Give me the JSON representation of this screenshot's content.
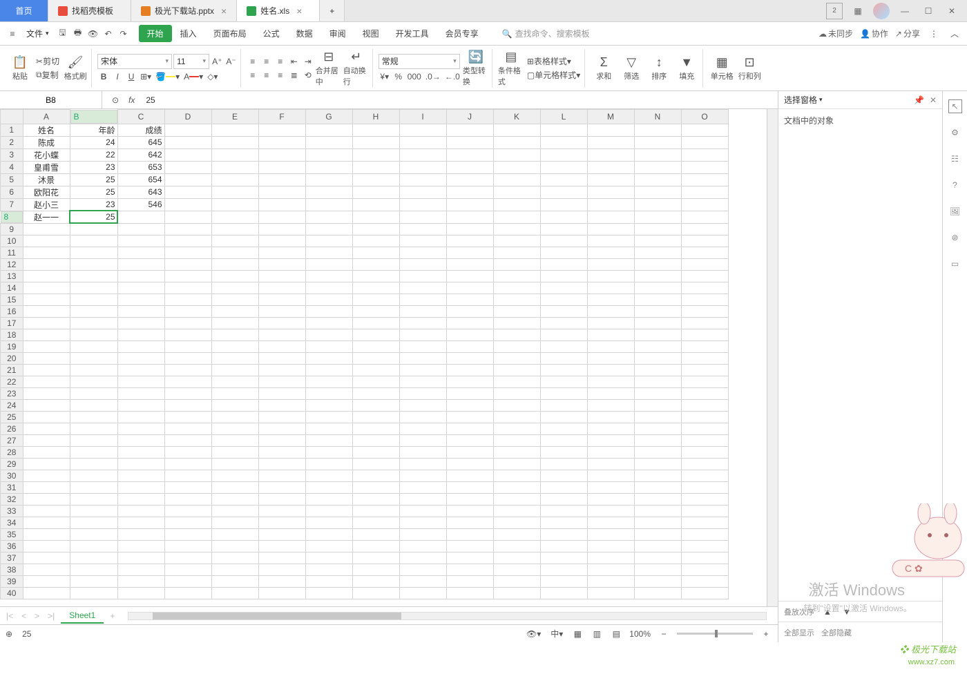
{
  "tabs": {
    "home": "首页",
    "t1": "找稻壳模板",
    "t2": "极光下载站.pptx",
    "t3": "姓名.xls"
  },
  "window": {
    "badge": "2"
  },
  "file_menu": "文件",
  "menus": [
    "开始",
    "插入",
    "页面布局",
    "公式",
    "数据",
    "审阅",
    "视图",
    "开发工具",
    "会员专享"
  ],
  "search_ph": "查找命令、搜索模板",
  "header_links": {
    "sync": "未同步",
    "coop": "协作",
    "share": "分享"
  },
  "ribbon": {
    "paste": "粘贴",
    "cut": "剪切",
    "copy": "复制",
    "fmt": "格式刷",
    "font": "宋体",
    "size": "11",
    "merge": "合并居中",
    "wrap": "自动换行",
    "numfmt": "常规",
    "typeconv": "类型转换",
    "cond": "条件格式",
    "tblfmt": "表格样式",
    "cellfmt": "单元格样式",
    "sum": "求和",
    "filter": "筛选",
    "sort": "排序",
    "fill": "填充",
    "cells": "单元格",
    "rowcol": "行和列"
  },
  "namebox": "B8",
  "formula": "25",
  "columns": [
    "A",
    "B",
    "C",
    "D",
    "E",
    "F",
    "G",
    "H",
    "I",
    "J",
    "K",
    "L",
    "M",
    "N",
    "O"
  ],
  "row_count": 40,
  "sel": {
    "row": 8,
    "col": 2
  },
  "data": [
    [
      "姓名",
      "年龄",
      "成绩"
    ],
    [
      "陈成",
      "24",
      "645"
    ],
    [
      "花小蝶",
      "22",
      "642"
    ],
    [
      "皇甫雪",
      "23",
      "653"
    ],
    [
      "沐景",
      "25",
      "654"
    ],
    [
      "欧阳花",
      "25",
      "643"
    ],
    [
      "赵小三",
      "23",
      "546"
    ],
    [
      "赵一一",
      "25",
      ""
    ]
  ],
  "panel": {
    "title": "选择窗格",
    "body": "文档中的对象",
    "stack": "叠放次序",
    "show_all": "全部显示",
    "hide_all": "全部隐藏"
  },
  "sheet": {
    "name": "Sheet1"
  },
  "status": {
    "val": "25",
    "zoom": "100%"
  },
  "watermark": {
    "l1": "激活 Windows",
    "l2": "转到\"设置\"以激活 Windows。",
    "l3": "❖ 极光下载站",
    "l4": "www.xz7.com"
  }
}
